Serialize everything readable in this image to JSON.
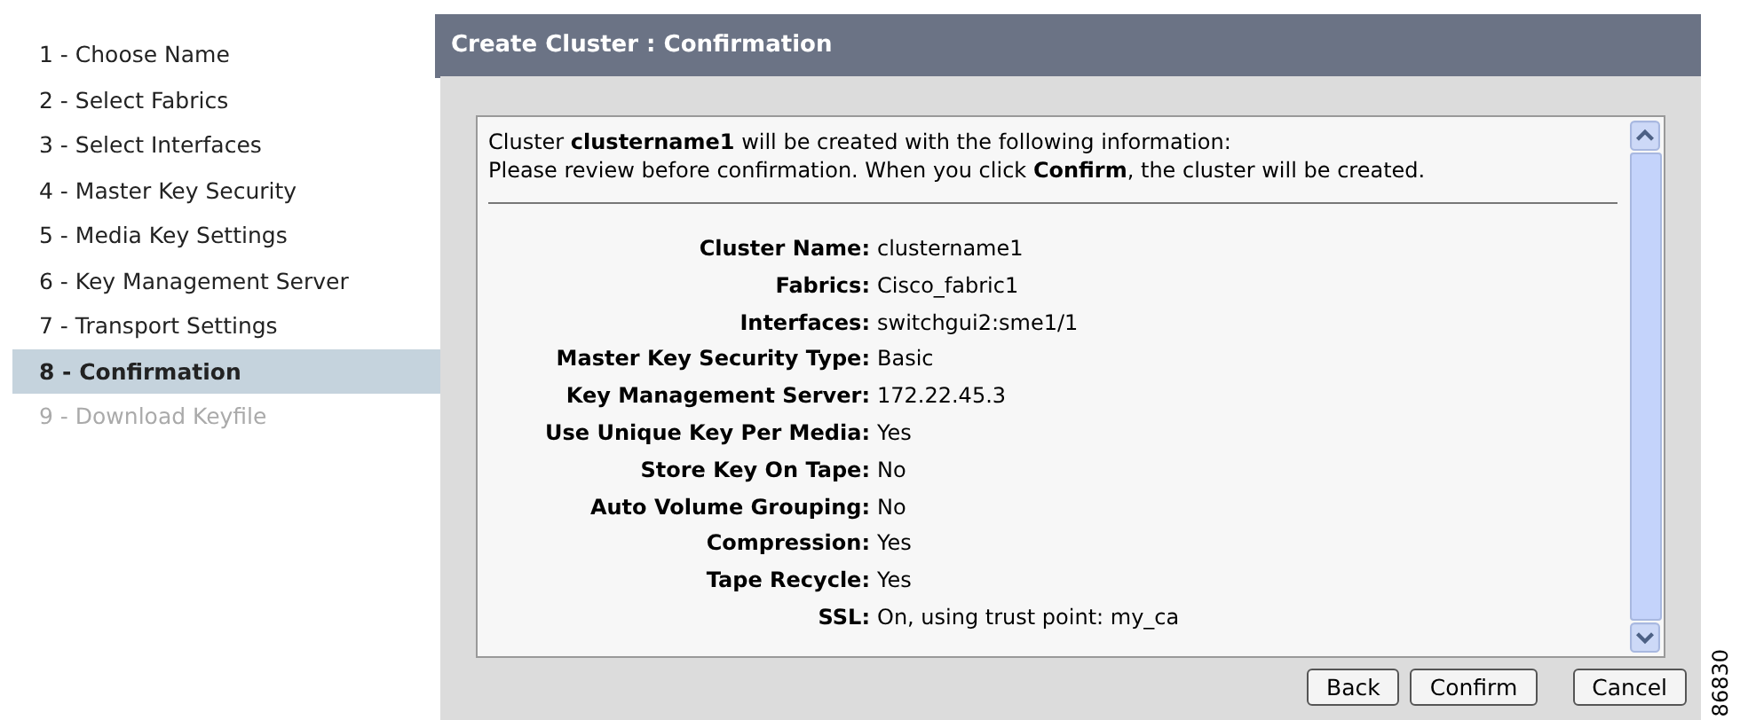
{
  "steps": [
    {
      "label": "1 - Choose Name",
      "selected": false,
      "disabled": false
    },
    {
      "label": "2 - Select Fabrics",
      "selected": false,
      "disabled": false
    },
    {
      "label": "3 - Select Interfaces",
      "selected": false,
      "disabled": false
    },
    {
      "label": "4 - Master Key Security",
      "selected": false,
      "disabled": false
    },
    {
      "label": "5 - Media Key Settings",
      "selected": false,
      "disabled": false
    },
    {
      "label": "6 - Key Management Server",
      "selected": false,
      "disabled": false
    },
    {
      "label": "7 - Transport Settings",
      "selected": false,
      "disabled": false
    },
    {
      "label": "8 - Confirmation",
      "selected": true,
      "disabled": false
    },
    {
      "label": "9 - Download Keyfile",
      "selected": false,
      "disabled": true
    }
  ],
  "panel": {
    "title": "Create Cluster : Confirmation",
    "intro": [
      "Cluster **clustername1** will be created with the following information:",
      "Please review before confirmation. When you click **Confirm**, the cluster will be created."
    ],
    "fields": [
      {
        "label": "Cluster Name:",
        "value": "clustername1"
      },
      {
        "label": "Fabrics:",
        "value": "Cisco_fabric1"
      },
      {
        "label": "Interfaces:",
        "value": "switchgui2:sme1/1"
      },
      {
        "label": "Master Key Security Type:",
        "value": "Basic"
      },
      {
        "label": "Key Management Server:",
        "value": "172.22.45.3"
      },
      {
        "label": "Use Unique Key Per Media:",
        "value": "Yes"
      },
      {
        "label": "Store Key On Tape:",
        "value": "No"
      },
      {
        "label": "Auto Volume Grouping:",
        "value": "No"
      },
      {
        "label": "Compression:",
        "value": "Yes"
      },
      {
        "label": "Tape Recycle:",
        "value": "Yes"
      },
      {
        "label": "SSL:",
        "value": "On, using trust point: my_ca"
      }
    ],
    "buttons": [
      "Back",
      "Confirm",
      "Cancel"
    ]
  },
  "figure_id": "86830"
}
